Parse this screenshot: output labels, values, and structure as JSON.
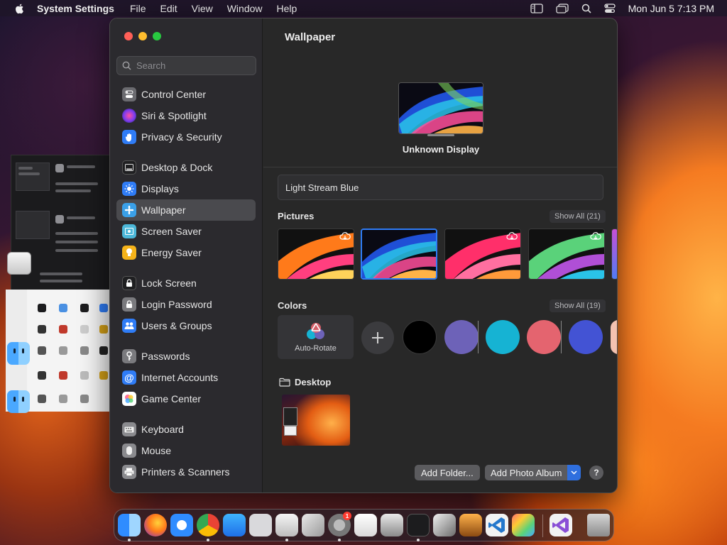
{
  "menubar": {
    "app_name": "System Settings",
    "items": [
      "File",
      "Edit",
      "View",
      "Window",
      "Help"
    ],
    "clock": "Mon Jun 5  7:13 PM"
  },
  "sidebar": {
    "search_placeholder": "Search",
    "items": [
      {
        "label": "Control Center",
        "icon": "control-center-icon",
        "color": "#6b6b70"
      },
      {
        "label": "Siri & Spotlight",
        "icon": "siri-icon",
        "color": "#8e3fd6"
      },
      {
        "label": "Privacy & Security",
        "icon": "hand-icon",
        "color": "#2f7cf6"
      },
      {
        "label": "Desktop & Dock",
        "icon": "dock-icon",
        "color": "#2b2b2e"
      },
      {
        "label": "Displays",
        "icon": "sun-icon",
        "color": "#2f7cf6"
      },
      {
        "label": "Wallpaper",
        "icon": "wallpaper-icon",
        "color": "#3aa0e8"
      },
      {
        "label": "Screen Saver",
        "icon": "screen-saver-icon",
        "color": "#4cb8d9"
      },
      {
        "label": "Energy Saver",
        "icon": "lightbulb-icon",
        "color": "#f5b31a"
      },
      {
        "label": "Lock Screen",
        "icon": "lock-icon",
        "color": "#2b2b2e"
      },
      {
        "label": "Login Password",
        "icon": "padlock-icon",
        "color": "#7a7a7e"
      },
      {
        "label": "Users & Groups",
        "icon": "users-icon",
        "color": "#2f7cf6"
      },
      {
        "label": "Passwords",
        "icon": "key-icon",
        "color": "#7a7a7e"
      },
      {
        "label": "Internet Accounts",
        "icon": "at-icon",
        "color": "#2f7cf6"
      },
      {
        "label": "Game Center",
        "icon": "game-center-icon",
        "color": "#ffffff"
      },
      {
        "label": "Keyboard",
        "icon": "keyboard-icon",
        "color": "#8a8a8e"
      },
      {
        "label": "Mouse",
        "icon": "mouse-icon",
        "color": "#8a8a8e"
      },
      {
        "label": "Printers & Scanners",
        "icon": "printer-icon",
        "color": "#8a8a8e"
      }
    ],
    "selected": "Wallpaper"
  },
  "content": {
    "title": "Wallpaper",
    "display_name": "Unknown Display",
    "wallpaper_name": "Light Stream Blue",
    "pictures": {
      "title": "Pictures",
      "show_all": "Show All (21)",
      "selected_index": 1
    },
    "colors": {
      "title": "Colors",
      "show_all": "Show All (19)",
      "auto_rotate_label": "Auto-Rotate",
      "swatches": [
        "#000000",
        "#6d62b8",
        "#16b3d3",
        "#e4646f",
        "#4353d4",
        "#f4c2b0"
      ]
    },
    "desktop_folder": {
      "title": "Desktop"
    },
    "buttons": {
      "add_folder": "Add Folder...",
      "add_photo_album": "Add Photo Album",
      "help": "?"
    }
  },
  "dock": {
    "items": [
      "Finder",
      "Firefox",
      "Safari",
      "Chrome",
      "App Store",
      "Screenshot",
      "Disk Utility",
      "Script Editor",
      "System Settings",
      "TextEdit",
      "Preview",
      "Terminal",
      "Xcode Instruments",
      "GarageBand",
      "Visual Studio Code",
      "Launchpad",
      "Visual Studio",
      "Trash"
    ],
    "badge_count": "1"
  }
}
